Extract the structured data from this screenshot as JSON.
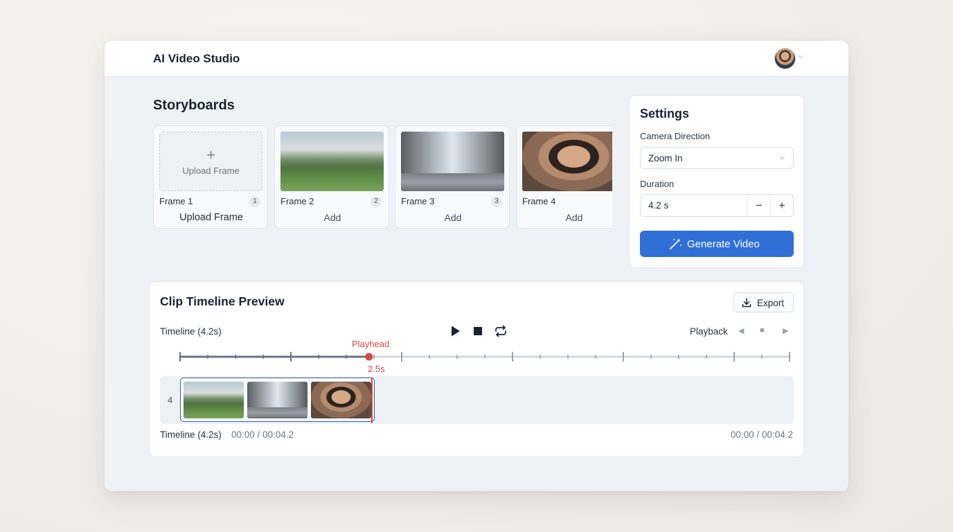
{
  "app": {
    "title": "AI Video Studio"
  },
  "storyboards": {
    "title": "Storyboards",
    "frames": [
      {
        "name": "Frame 1",
        "badge": "1",
        "action": "Upload Frame",
        "placeholder": "Upload Frame"
      },
      {
        "name": "Frame 2",
        "badge": "2",
        "action": "Add"
      },
      {
        "name": "Frame 3",
        "badge": "3",
        "action": "Add"
      },
      {
        "name": "Frame 4",
        "action": "Add"
      }
    ]
  },
  "settings": {
    "title": "Settings",
    "camera_label": "Camera Direction",
    "camera_value": "Zoom In",
    "duration_label": "Duration",
    "duration_value": "4.2 s",
    "generate_label": "Generate Video"
  },
  "timeline": {
    "title": "Clip Timeline Preview",
    "export_label": "Export",
    "label": "Timeline (4.2s)",
    "playback_label": "Playback",
    "playhead_label": "Playhead",
    "playhead_time": "2.5s",
    "playhead_fraction": 0.31,
    "track_number": "4",
    "footer_label": "Timeline (4.2s)",
    "footer_time_left": "00:00 / 00:04.2",
    "footer_time_right": "00:00 / 00:04.2"
  },
  "colors": {
    "accent": "#2f6fd6",
    "playhead": "#d94848"
  }
}
